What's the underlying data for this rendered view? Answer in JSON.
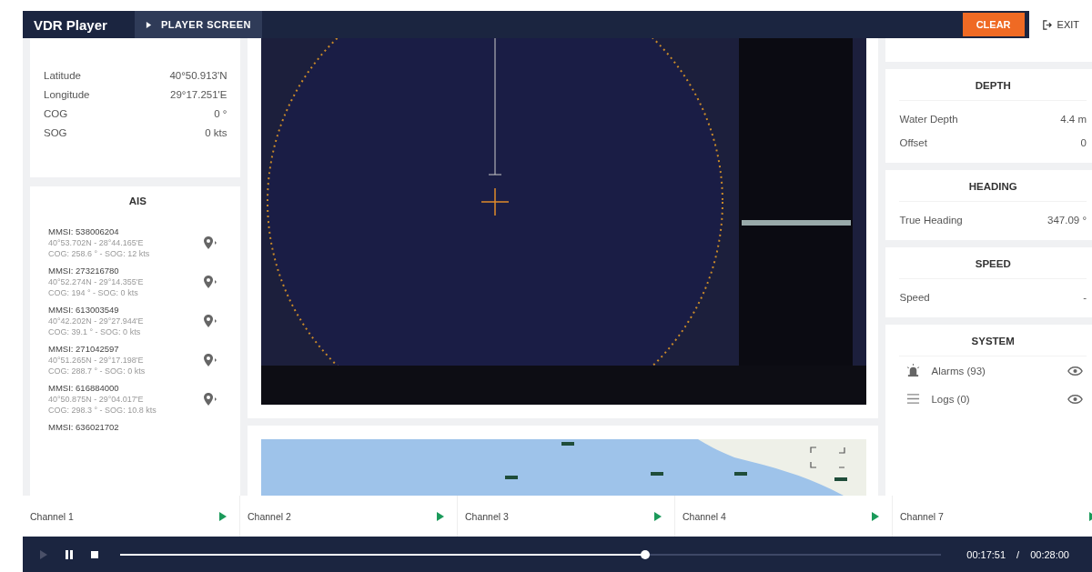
{
  "header": {
    "title": "VDR Player",
    "tabs": [
      {
        "label": "PLAYER SCREEN",
        "selected": true
      }
    ],
    "clear_button": "CLEAR",
    "exit_button": "EXIT"
  },
  "position": [
    {
      "label": "Latitude",
      "value": "40°50.913'N"
    },
    {
      "label": "Longitude",
      "value": "29°17.251'E"
    },
    {
      "label": "COG",
      "value": "0 °"
    },
    {
      "label": "SOG",
      "value": "0 kts"
    }
  ],
  "ais": {
    "title": "AIS",
    "vessels": [
      {
        "mmsi": "MMSI: 538006204",
        "position": "40°53.702N - 28°44.165'E",
        "motion": "COG: 258.6 ° - SOG: 12 kts"
      },
      {
        "mmsi": "MMSI: 273216780",
        "position": "40°52.274N - 29°14.355'E",
        "motion": "COG: 194 ° - SOG: 0 kts"
      },
      {
        "mmsi": "MMSI: 613003549",
        "position": "40°42.202N - 29°27.944'E",
        "motion": "COG: 39.1 ° - SOG: 0 kts"
      },
      {
        "mmsi": "MMSI: 271042597",
        "position": "40°51.265N - 29°17.198'E",
        "motion": "COG: 288.7 ° - SOG: 0 kts"
      },
      {
        "mmsi": "MMSI: 616884000",
        "position": "40°50.875N - 29°04.017'E",
        "motion": "COG: 298.3 ° - SOG: 10.8 kts"
      },
      {
        "mmsi": "MMSI: 636021702"
      }
    ]
  },
  "panels": [
    {
      "title": "DEPTH",
      "rows": [
        {
          "label": "Water Depth",
          "value": "4.4 m"
        },
        {
          "label": "Offset",
          "value": "0"
        }
      ]
    },
    {
      "title": "HEADING",
      "rows": [
        {
          "label": "True Heading",
          "value": "347.09 °"
        }
      ]
    },
    {
      "title": "SPEED",
      "rows": [
        {
          "label": "Speed",
          "value": "-"
        }
      ]
    }
  ],
  "system": {
    "title": "SYSTEM",
    "items": [
      {
        "kind": "alarms",
        "label": "Alarms (93)"
      },
      {
        "kind": "logs",
        "label": "Logs (0)"
      }
    ]
  },
  "channels": [
    "Channel 1",
    "Channel 2",
    "Channel 3",
    "Channel 4",
    "Channel 7"
  ],
  "player": {
    "level": 0.64,
    "elapsed": "00:17:51",
    "separator": "/",
    "total": "00:28:00"
  }
}
